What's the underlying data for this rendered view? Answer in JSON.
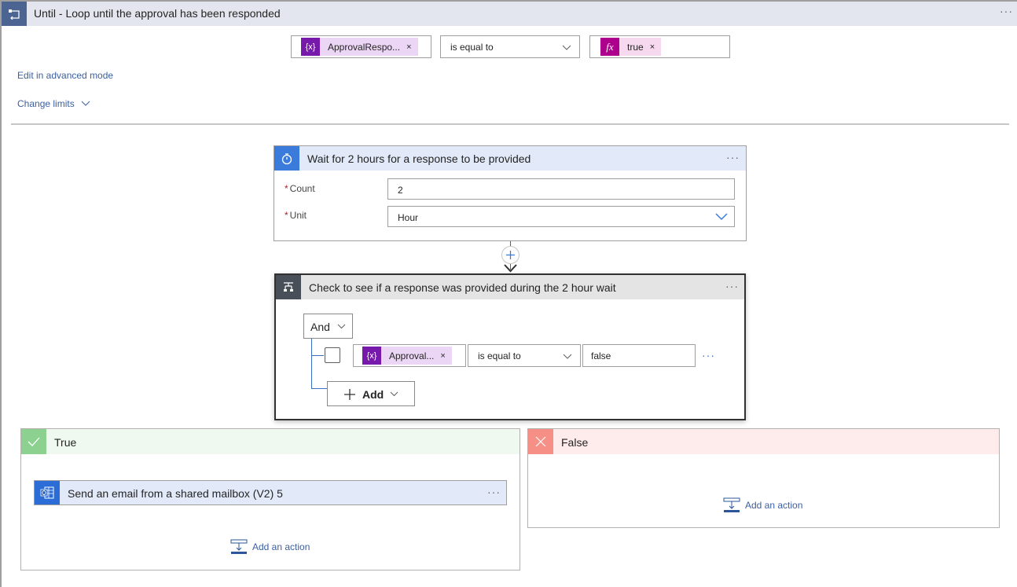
{
  "until": {
    "title": "Until - Loop until the approval has been responded",
    "more": "···",
    "condition": {
      "left_token": {
        "label": "ApprovalRespo...",
        "remove": "×",
        "icon": "{x}"
      },
      "operator": "is equal to",
      "right_token": {
        "label": "true",
        "remove": "×",
        "icon": "fx"
      }
    },
    "edit_advanced_label": "Edit in advanced mode",
    "change_limits_label": "Change limits"
  },
  "delay_card": {
    "title": "Wait for 2 hours for a response to be provided",
    "more": "···",
    "fields": [
      {
        "label": "Count",
        "required": "*",
        "value": "2"
      },
      {
        "label": "Unit",
        "required": "*",
        "value": "Hour"
      }
    ]
  },
  "insert_step": {
    "icon": "plus-icon"
  },
  "condition_card": {
    "title": "Check to see if a response was provided during the 2 hour wait",
    "more": "···",
    "group_operator": "And",
    "row": {
      "left_token": {
        "label": "Approval...",
        "remove": "×",
        "icon": "{x}"
      },
      "operator": "is equal to",
      "value": "false",
      "more": "···"
    },
    "add_label": "Add"
  },
  "branches": {
    "true": {
      "title": "True",
      "action": {
        "title": "Send an email from a shared mailbox (V2) 5",
        "more": "···"
      },
      "add_action_label": "Add an action"
    },
    "false": {
      "title": "False",
      "add_action_label": "Add an action"
    }
  },
  "colors": {
    "accent_link": "#3b5fa0",
    "variable_token": "#7719aa",
    "expression_token": "#ad008c",
    "true_green": "#8cd190",
    "false_red": "#f68f86",
    "control_dark": "#484f58",
    "delay_blue": "#3a7bdc"
  }
}
